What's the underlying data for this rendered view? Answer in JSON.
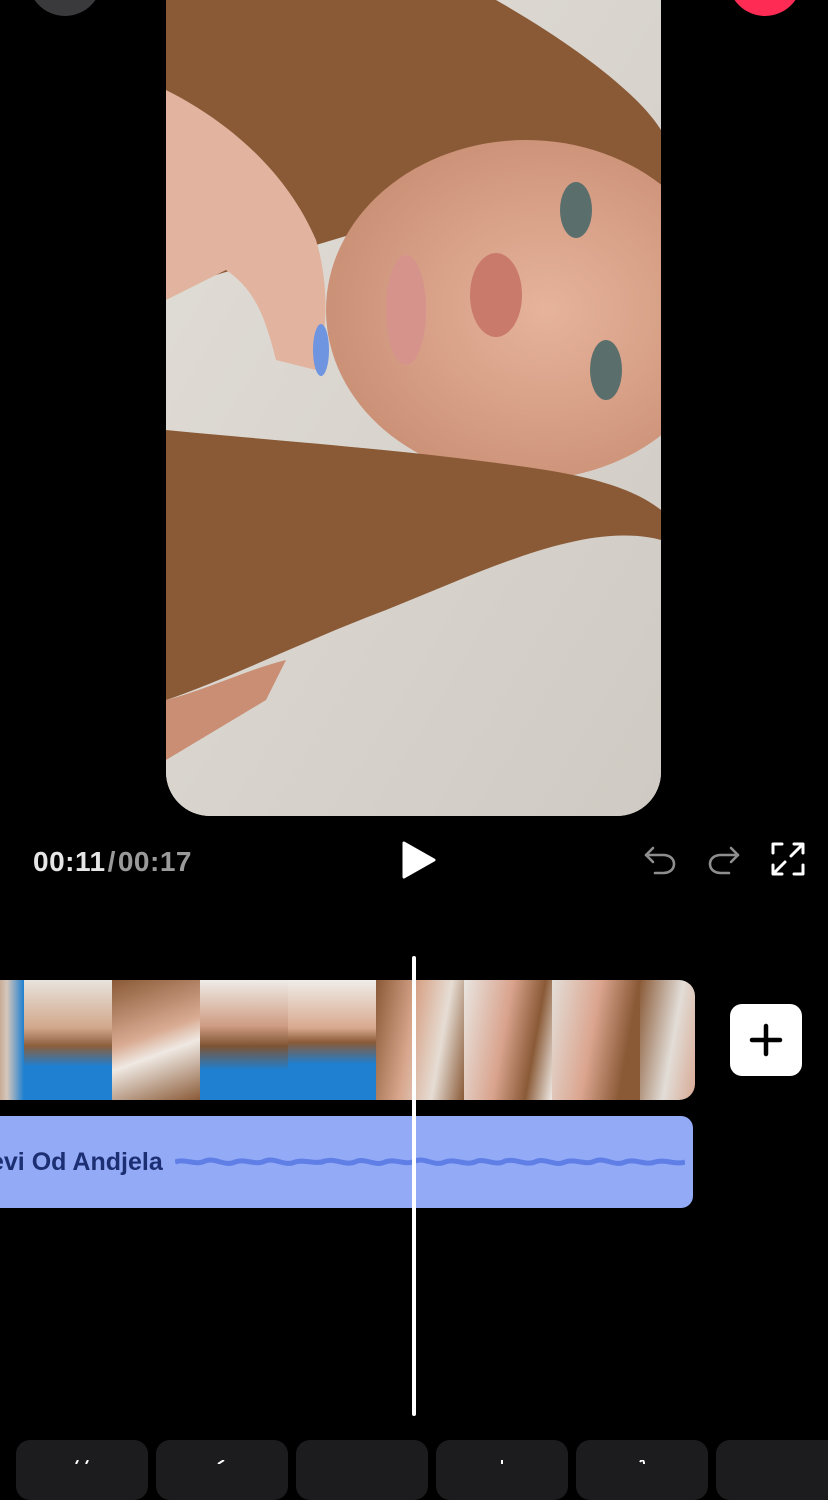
{
  "playback": {
    "current_time": "00:11",
    "separator": "/",
    "total_time": "00:17"
  },
  "icons": {
    "play": "play-icon",
    "undo": "undo-icon",
    "redo": "redo-icon",
    "fullscreen": "fullscreen-icon",
    "add": "plus-icon"
  },
  "timeline": {
    "audio_track_label": "evi Od Andjela"
  },
  "colors": {
    "accent_red": "#fe2c55",
    "audio_track": "#93aaf7",
    "audio_text": "#1d2f73"
  }
}
